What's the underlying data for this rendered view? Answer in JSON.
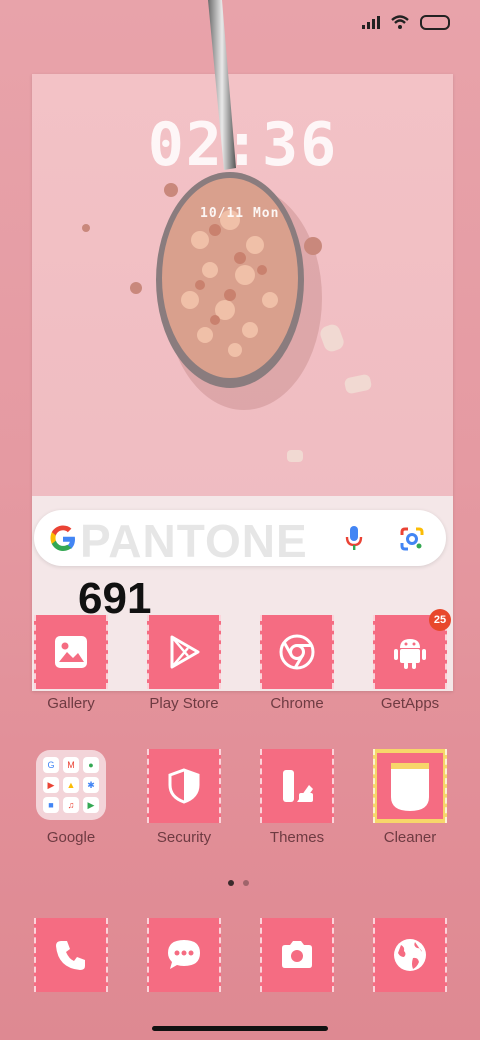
{
  "status_bar": {
    "signal_icon": "signal-icon",
    "wifi_icon": "wifi-icon",
    "battery_icon": "battery-icon"
  },
  "widget": {
    "clock": "02:36",
    "date": "10/11 Mon",
    "brand": "PANTONE",
    "code": "691",
    "search_icons": [
      "google-logo-icon",
      "microphone-icon",
      "google-lens-icon"
    ]
  },
  "apps_row1": [
    {
      "label": "Gallery",
      "icon": "gallery-icon"
    },
    {
      "label": "Play Store",
      "icon": "play-store-icon"
    },
    {
      "label": "Chrome",
      "icon": "chrome-icon"
    },
    {
      "label": "GetApps",
      "icon": "android-icon",
      "badge": "25"
    }
  ],
  "apps_row2": [
    {
      "label": "Google",
      "icon": "folder-icon"
    },
    {
      "label": "Security",
      "icon": "shield-icon"
    },
    {
      "label": "Themes",
      "icon": "themes-icon"
    },
    {
      "label": "Cleaner",
      "icon": "cleaner-icon"
    }
  ],
  "dock": [
    {
      "icon": "phone-icon"
    },
    {
      "icon": "messages-icon"
    },
    {
      "icon": "camera-icon"
    },
    {
      "icon": "browser-globe-icon"
    }
  ],
  "page_indicator": {
    "pages": 2,
    "current": 1
  },
  "colors": {
    "tile": "#f56c82",
    "badge": "#e8482c",
    "label": "#6e3b42"
  }
}
